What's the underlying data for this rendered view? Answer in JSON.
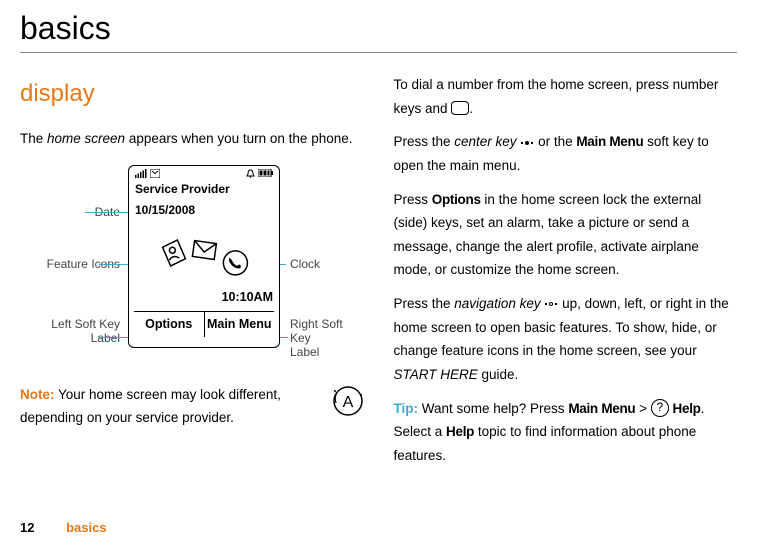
{
  "page_title": "basics",
  "section_title": "display",
  "left": {
    "intro_pre": "The ",
    "intro_em": "home screen",
    "intro_post": " appears when you turn on the phone.",
    "note_label": "Note:",
    "note_text": " Your home screen may look different, depending on your service provider."
  },
  "phone": {
    "provider": "Service Provider",
    "date": "10/15/2008",
    "clock": "10:10AM",
    "left_softkey": "Options",
    "right_softkey": "Main Menu"
  },
  "callouts": {
    "date": "Date",
    "feature_icons": "Feature Icons",
    "left_softkey_1": "Left Soft Key",
    "left_softkey_2": "Label",
    "clock": "Clock",
    "right_softkey_1": "Right Soft Key",
    "right_softkey_2": "Label"
  },
  "right": {
    "p1_pre": "To dial a number from the home screen, press number keys and ",
    "p1_post": ".",
    "p2_pre": "Press the ",
    "p2_em": "center key",
    "p2_mid": " or the ",
    "p2_bold": "Main Menu",
    "p2_post": " soft key to open the main menu.",
    "p3_pre": "Press ",
    "p3_bold": "Options",
    "p3_post": " in the home screen lock the external (side) keys, set an alarm, take a picture or send a message, change the alert profile, activate airplane mode, or customize the home screen.",
    "p4_pre": "Press the ",
    "p4_em": "navigation key",
    "p4_mid": " up, down, left, or right in the home screen to open basic features. To show, hide, or change feature icons in the home screen, see your ",
    "p4_em2": "START HERE",
    "p4_post": " guide.",
    "tip_label": "Tip:",
    "p5_pre": " Want some help? Press ",
    "p5_bold1": "Main Menu",
    "p5_gt": " > ",
    "p5_bold2": "Help",
    "p5_mid": ". Select a ",
    "p5_bold3": "Help",
    "p5_post": " topic to find information about phone features."
  },
  "footer": {
    "page_number": "12",
    "section": "basics"
  }
}
